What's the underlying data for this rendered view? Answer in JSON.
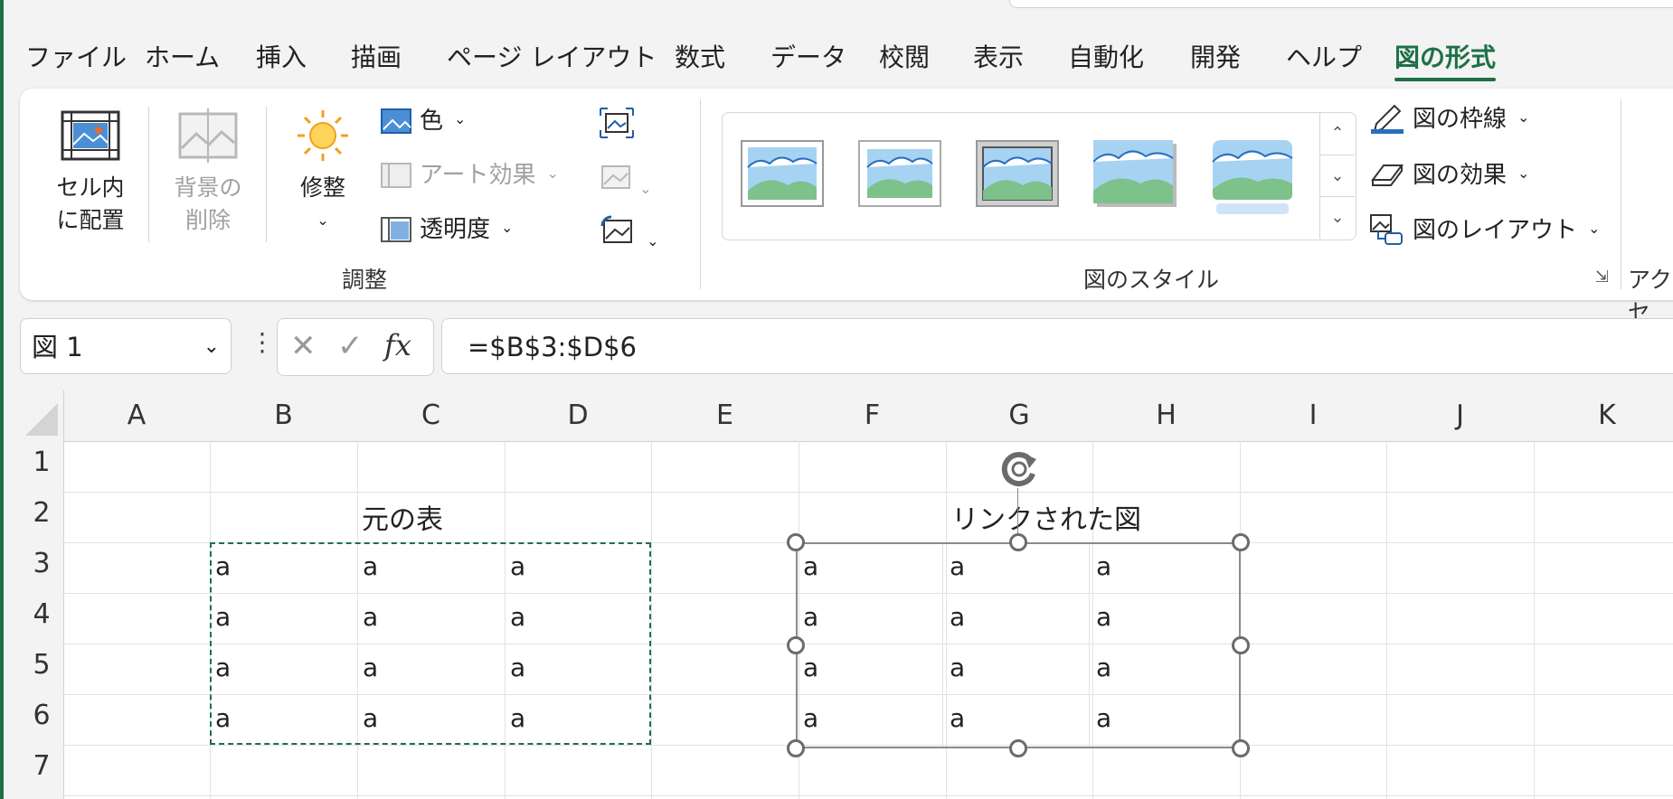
{
  "tabs": [
    "ファイル",
    "ホーム",
    "挿入",
    "描画",
    "ページ レイアウト",
    "数式",
    "データ",
    "校閲",
    "表示",
    "自動化",
    "開発",
    "ヘルプ",
    "図の形式"
  ],
  "ribbon": {
    "place_in_cell_line1": "セル内",
    "place_in_cell_line2": "に配置",
    "remove_bg_line1": "背景の",
    "remove_bg_line2": "削除",
    "corrections": "修整",
    "color": "色",
    "artistic_effects": "アート効果",
    "transparency": "透明度",
    "group_adjust": "調整",
    "picture_border": "図の枠線",
    "picture_effects": "図の効果",
    "picture_layout": "図のレイアウト",
    "group_styles": "図のスタイル",
    "group_accessibility": "アクセ"
  },
  "formula_bar": {
    "name_box": "図 1",
    "formula": "=$B$3:$D$6"
  },
  "columns": [
    "A",
    "B",
    "C",
    "D",
    "E",
    "F",
    "G",
    "H",
    "I",
    "J",
    "K"
  ],
  "rows": [
    "1",
    "2",
    "3",
    "4",
    "5",
    "6",
    "7"
  ],
  "cells": {
    "c2": "元の表",
    "g2": "リンクされた図",
    "source_table": [
      [
        "a",
        "a",
        "a"
      ],
      [
        "a",
        "a",
        "a"
      ],
      [
        "a",
        "a",
        "a"
      ],
      [
        "a",
        "a",
        "a"
      ]
    ],
    "linked_picture": [
      [
        "a",
        "a",
        "a"
      ],
      [
        "a",
        "a",
        "a"
      ],
      [
        "a",
        "a",
        "a"
      ],
      [
        "a",
        "a",
        "a"
      ]
    ]
  },
  "colors": {
    "accent": "#1e7145",
    "selection": "#1e7145"
  }
}
